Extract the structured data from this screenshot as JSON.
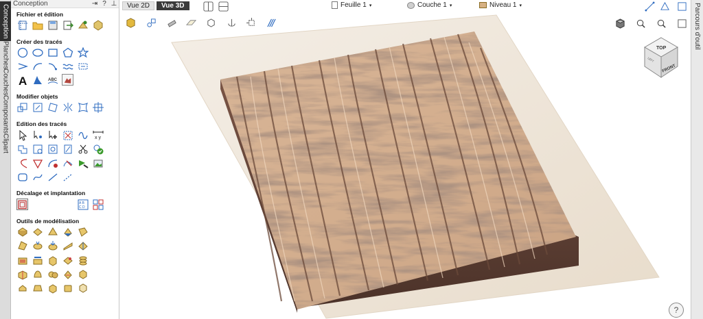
{
  "left_tabs": [
    {
      "label": "Conception",
      "active": true
    },
    {
      "label": "Planches",
      "active": false
    },
    {
      "label": "Couches",
      "active": false
    },
    {
      "label": "Composants",
      "active": false
    },
    {
      "label": "Clipart",
      "active": false
    }
  ],
  "panel": {
    "title": "Conception",
    "buttons": [
      "⇥",
      "?",
      "⊥"
    ],
    "sections": [
      {
        "title": "Fichier et édition"
      },
      {
        "title": "Créer des tracés"
      },
      {
        "title": "Modifier objets"
      },
      {
        "title": "Edition des tracés"
      },
      {
        "title": "Décalage et implantation"
      },
      {
        "title": "Outils de modélisation"
      }
    ]
  },
  "right_tab": {
    "label": "Parcours d'outil"
  },
  "view": {
    "tabs": [
      {
        "label": "Vue 2D",
        "active": false
      },
      {
        "label": "Vue 3D",
        "active": true
      }
    ],
    "sheet": "Feuille 1",
    "layer": "Couche 1",
    "level": "Niveau 1"
  },
  "cube": {
    "top": "TOP",
    "front": "FRONT",
    "left": "LEFT"
  },
  "help": "?",
  "colors": {
    "bark_light": "#d9b69a",
    "bark_dark": "#6b4a3a",
    "board": "#efe6da",
    "active_tab": "#2f2f2f"
  }
}
